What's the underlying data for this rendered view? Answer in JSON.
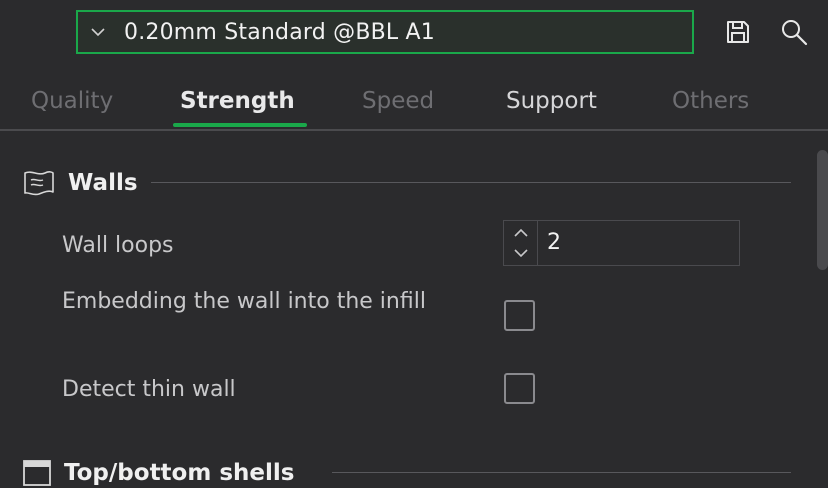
{
  "profile": {
    "value": "0.20mm Standard @BBL A1"
  },
  "toolbar": {
    "save_icon": "save-icon",
    "search_icon": "search-icon"
  },
  "tabs": [
    {
      "label": "Quality",
      "active": false
    },
    {
      "label": "Strength",
      "active": true
    },
    {
      "label": "Speed",
      "active": false
    },
    {
      "label": "Support",
      "active": false
    },
    {
      "label": "Others",
      "active": false
    }
  ],
  "sections": {
    "walls": {
      "title": "Walls",
      "icon": "walls-icon",
      "rows": {
        "wall_loops": {
          "label": "Wall loops",
          "value": "2"
        },
        "embed_wall": {
          "label": "Embedding the wall into the infill",
          "checked": false
        },
        "detect_thin_wall": {
          "label": "Detect thin wall",
          "checked": false
        }
      }
    },
    "top_bottom": {
      "title": "Top/bottom shells",
      "icon": "shell-icon"
    }
  },
  "colors": {
    "accent": "#1aa84a",
    "background": "#2b2b2d",
    "text": "#e6e6e6",
    "muted": "#6e6e72"
  }
}
